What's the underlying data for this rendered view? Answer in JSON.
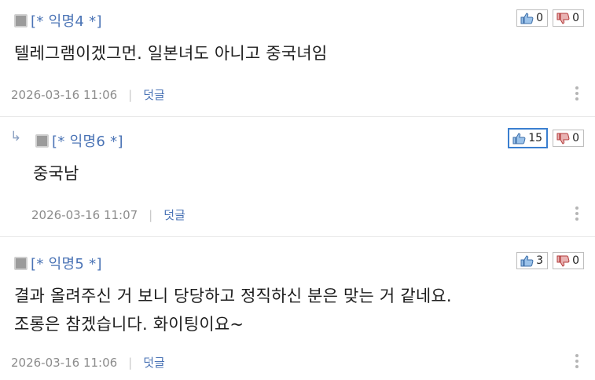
{
  "comments": [
    {
      "author": "[* 익명4 *]",
      "text": "텔레그램이겠그먼. 일본녀도 아니고 중국녀임",
      "date": "2026-03-16 11:06",
      "reply_label": "덧글",
      "likes": "0",
      "dislikes": "0",
      "is_reply": false
    },
    {
      "author": "[* 익명6 *]",
      "text": "중국남",
      "date": "2026-03-16 11:07",
      "reply_label": "덧글",
      "likes": "15",
      "dislikes": "0",
      "is_reply": true,
      "reply_marker": "↳"
    },
    {
      "author": "[* 익명5 *]",
      "text_lines": [
        "결과 올려주신 거 보니 당당하고 정직하신 분은 맞는 거 같네요.",
        "조롱은 참겠습니다. 화이팅이요~"
      ],
      "date": "2026-03-16 11:06",
      "reply_label": "덧글",
      "likes": "3",
      "dislikes": "0",
      "is_reply": false
    }
  ],
  "colors": {
    "accent": "#4a73b5",
    "highlight_border": "#3a7fd0",
    "dislike_icon": "#b23a3a"
  },
  "icons": [
    "thumbs-up-icon",
    "thumbs-down-icon",
    "reply-arrow-icon",
    "more-options-icon"
  ]
}
